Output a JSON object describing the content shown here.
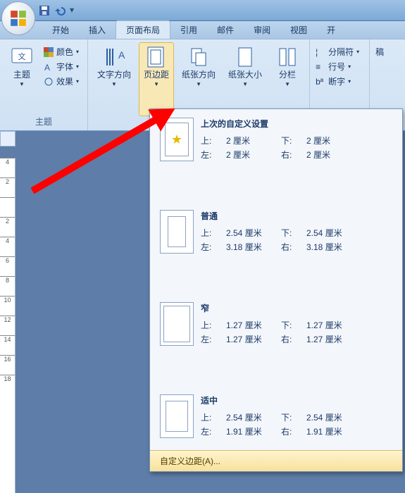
{
  "qat": {
    "save": "保存",
    "undo": "撤销"
  },
  "tabs": {
    "items": [
      "开始",
      "插入",
      "页面布局",
      "引用",
      "邮件",
      "审阅",
      "视图",
      "开"
    ],
    "activeIndex": 2
  },
  "ribbon": {
    "theme": {
      "label": "主题",
      "themes_btn": "主题",
      "colors": "颜色",
      "fonts": "字体",
      "effects": "效果"
    },
    "pagesetup": {
      "text_direction": "文字方向",
      "margins": "页边距",
      "orientation": "纸张方向",
      "size": "纸张大小",
      "columns": "分栏"
    },
    "breaks": {
      "breaks": "分隔符",
      "line_numbers": "行号",
      "hyphenation": "断字"
    },
    "right_stub": "稿"
  },
  "marginPanel": {
    "last": {
      "title": "上次的自定义设置",
      "top_l": "上:",
      "top_v": "2 厘米",
      "bot_l": "下:",
      "bot_v": "2 厘米",
      "left_l": "左:",
      "left_v": "2 厘米",
      "right_l": "右:",
      "right_v": "2 厘米"
    },
    "normal": {
      "title": "普通",
      "top_l": "上:",
      "top_v": "2.54 厘米",
      "bot_l": "下:",
      "bot_v": "2.54 厘米",
      "left_l": "左:",
      "left_v": "3.18 厘米",
      "right_l": "右:",
      "right_v": "3.18 厘米"
    },
    "narrow": {
      "title": "窄",
      "top_l": "上:",
      "top_v": "1.27 厘米",
      "bot_l": "下:",
      "bot_v": "1.27 厘米",
      "left_l": "左:",
      "left_v": "1.27 厘米",
      "right_l": "右:",
      "right_v": "1.27 厘米"
    },
    "moderate": {
      "title": "适中",
      "top_l": "上:",
      "top_v": "2.54 厘米",
      "bot_l": "下:",
      "bot_v": "2.54 厘米",
      "left_l": "左:",
      "left_v": "1.91 厘米",
      "right_l": "右:",
      "right_v": "1.91 厘米"
    },
    "custom": "自定义边距(A)..."
  },
  "ruler": [
    "4",
    "2",
    "",
    "2",
    "4",
    "6",
    "8",
    "10",
    "12",
    "14",
    "16",
    "18"
  ]
}
